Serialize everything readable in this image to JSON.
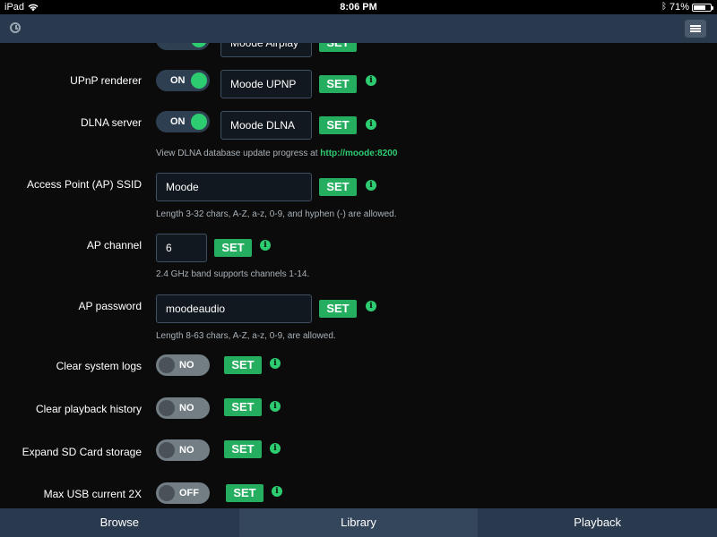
{
  "statusbar": {
    "device": "iPad",
    "time": "8:06 PM",
    "battery": "71%",
    "battery_level": 0.71
  },
  "settings": {
    "airplay": {
      "value": "Moode Airplay",
      "set_label": "SET",
      "info": "i"
    },
    "upnp": {
      "label": "UPnP renderer",
      "toggle": "ON",
      "value": "Moode UPNP",
      "set_label": "SET",
      "info": "i"
    },
    "dlna": {
      "label": "DLNA server",
      "toggle": "ON",
      "value": "Moode DLNA",
      "set_label": "SET",
      "info": "i",
      "help_text": "View DLNA database update progress at ",
      "help_link": "http://moode:8200"
    },
    "ap_ssid": {
      "label": "Access Point (AP) SSID",
      "value": "Moode",
      "set_label": "SET",
      "info": "i",
      "help_text": "Length 3-32 chars, A-Z, a-z, 0-9, and hyphen (-) are allowed."
    },
    "ap_channel": {
      "label": "AP channel",
      "value": "6",
      "set_label": "SET",
      "info": "i",
      "help_text": "2.4 GHz band supports channels 1-14."
    },
    "ap_password": {
      "label": "AP password",
      "value": "moodeaudio",
      "set_label": "SET",
      "info": "i",
      "help_text": "Length 8-63 chars, A-Z, a-z, 0-9, are allowed."
    },
    "clear_logs": {
      "label": "Clear system logs",
      "toggle": "NO",
      "set_label": "SET",
      "info": "i"
    },
    "clear_history": {
      "label": "Clear playback history",
      "toggle": "NO",
      "set_label": "SET",
      "info": "i"
    },
    "expand_sd": {
      "label": "Expand SD Card storage",
      "toggle": "NO",
      "set_label": "SET",
      "info": "i"
    },
    "usb_current": {
      "label": "Max USB current 2X",
      "toggle": "OFF",
      "set_label": "SET",
      "info": "i"
    }
  },
  "tabs": [
    {
      "label": "Browse"
    },
    {
      "label": "Library"
    },
    {
      "label": "Playback"
    }
  ],
  "colors": {
    "accent": "#26ae60",
    "header": "#2a3a4e",
    "background": "#0b0b0b"
  }
}
